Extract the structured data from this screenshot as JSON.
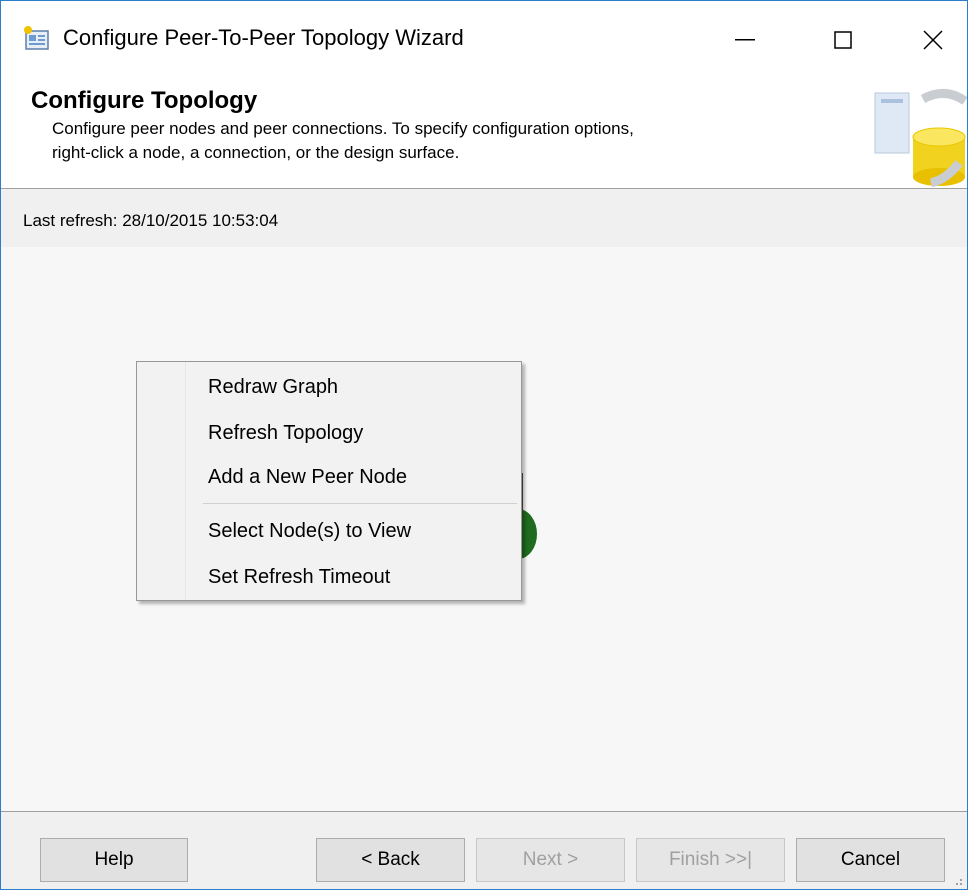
{
  "window": {
    "title": "Configure Peer-To-Peer Topology Wizard",
    "controls": {
      "minimize": "—",
      "maximize": "☐",
      "close": "✕"
    }
  },
  "header": {
    "title": "Configure Topology",
    "description_line1": "Configure peer nodes and peer connections. To specify configuration options,",
    "description_line2": "right-click a node, a connection, or the design surface."
  },
  "status": {
    "last_refresh": "Last refresh: 28/10/2015 10:53:04"
  },
  "context_menu": {
    "items": [
      {
        "label": "Redraw Graph"
      },
      {
        "label": "Refresh Topology"
      },
      {
        "label": "Add a New Peer Node"
      },
      {
        "label": "Select Node(s) to View"
      },
      {
        "label": "Set Refresh Timeout"
      }
    ]
  },
  "footer": {
    "help": "Help",
    "back": "< Back",
    "next": "Next >",
    "finish": "Finish >>|",
    "cancel": "Cancel"
  },
  "colors": {
    "window_border": "#2b7ec9",
    "node_green": "#1f6b1f",
    "disabled_text": "#a0a0a0"
  },
  "icons": {
    "app": "wizard-app-icon",
    "header": "database-replication-icon"
  }
}
